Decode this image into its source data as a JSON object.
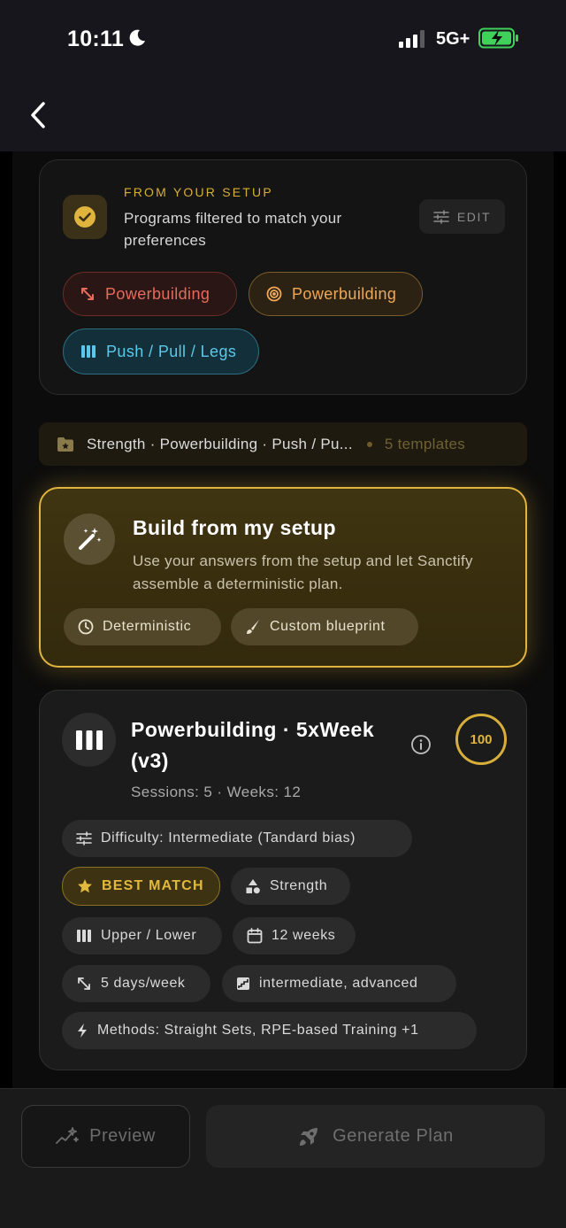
{
  "status_bar": {
    "time": "10:11",
    "network": "5G+"
  },
  "setup": {
    "eyebrow": "FROM YOUR SETUP",
    "description": "Programs filtered to match your preferences",
    "edit_label": "EDIT",
    "chips": [
      {
        "label": "Powerbuilding",
        "icon": "arrows-diagonal-icon",
        "color": "#e66b5d"
      },
      {
        "label": "Powerbuilding",
        "icon": "target-icon",
        "color": "#f0a857"
      },
      {
        "label": "Push / Pull / Legs",
        "icon": "columns-icon",
        "color": "#5bc8eb"
      }
    ]
  },
  "filter": {
    "summary": "Strength · Powerbuilding · Push / Pu...",
    "count": "5 templates"
  },
  "build": {
    "title": "Build from my setup",
    "description": "Use your answers from the setup and let Sanctify assemble a deterministic plan.",
    "chips": [
      {
        "label": "Deterministic",
        "icon": "clock-icon"
      },
      {
        "label": "Custom blueprint",
        "icon": "brush-icon"
      }
    ]
  },
  "program": {
    "title": "Powerbuilding · 5xWeek (v3)",
    "meta": "Sessions: 5 · Weeks: 12",
    "score": "100",
    "tags": {
      "difficulty": "Difficulty: Intermediate (Tandard bias)",
      "best_match": "BEST MATCH",
      "strength": "Strength",
      "split": "Upper / Lower",
      "weeks": "12 weeks",
      "frequency": "5 days/week",
      "level": "intermediate, advanced",
      "methods": "Methods: Straight Sets, RPE-based Training +1"
    }
  },
  "actions": {
    "preview": "Preview",
    "generate": "Generate Plan"
  },
  "colors": {
    "accent_gold": "#e1b53d",
    "background": "#000000"
  }
}
